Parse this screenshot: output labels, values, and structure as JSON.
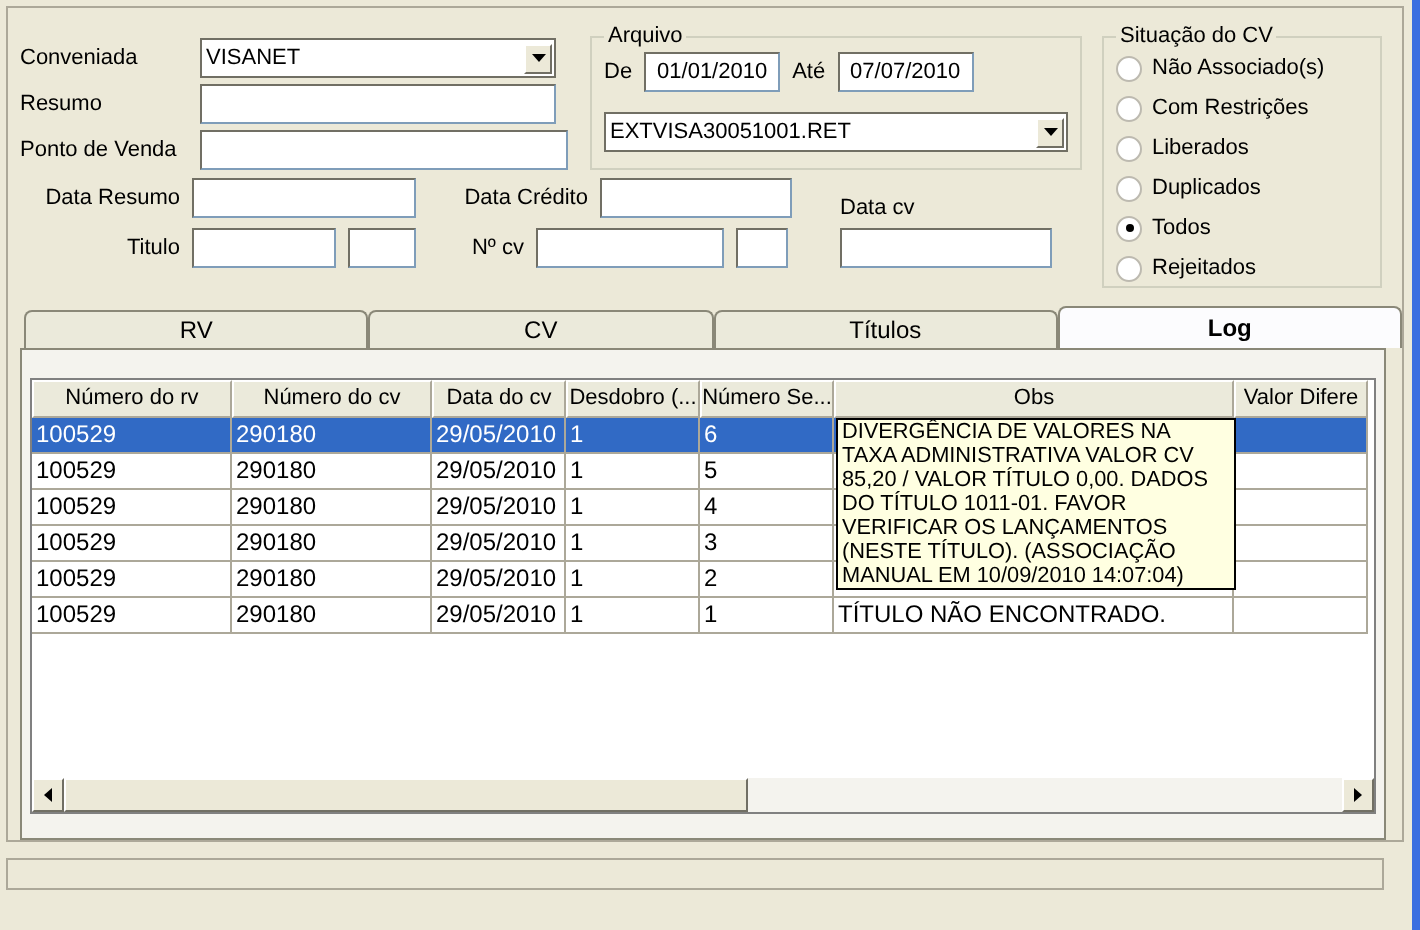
{
  "filters": {
    "conveniada": {
      "label": "Conveniada",
      "value": "VISANET"
    },
    "resumo": {
      "label": "Resumo"
    },
    "ponto_de_venda": {
      "label": "Ponto de Venda"
    },
    "data_resumo": {
      "label": "Data Resumo"
    },
    "data_credito": {
      "label": "Data Crédito"
    },
    "titulo": {
      "label": "Titulo"
    },
    "n_cv": {
      "label": "Nº cv"
    },
    "data_cv": {
      "label": "Data cv"
    }
  },
  "arquivo": {
    "title": "Arquivo",
    "de_label": "De",
    "de": "01/01/2010",
    "ate_label": "Até",
    "ate": "07/07/2010",
    "file": "EXTVISA30051001.RET"
  },
  "situacao": {
    "title": "Situação do CV",
    "options": [
      {
        "label": "Não Associado(s)",
        "selected": false
      },
      {
        "label": "Com Restrições",
        "selected": false
      },
      {
        "label": "Liberados",
        "selected": false
      },
      {
        "label": "Duplicados",
        "selected": false
      },
      {
        "label": "Todos",
        "selected": true
      },
      {
        "label": "Rejeitados",
        "selected": false
      }
    ]
  },
  "tabs": [
    {
      "label": "RV",
      "selected": false
    },
    {
      "label": "CV",
      "selected": false
    },
    {
      "label": "Títulos",
      "selected": false
    },
    {
      "label": "Log",
      "selected": true
    }
  ],
  "table": {
    "columns": [
      "Número do rv",
      "Número do cv",
      "Data do cv",
      "Desdobro (...",
      "Número Se...",
      "Obs",
      "Valor Difere"
    ],
    "rows": [
      {
        "selected": true,
        "cells": [
          "100529",
          "290180",
          "29/05/2010",
          "1",
          "6"
        ]
      },
      {
        "selected": false,
        "cells": [
          "100529",
          "290180",
          "29/05/2010",
          "1",
          "5"
        ]
      },
      {
        "selected": false,
        "cells": [
          "100529",
          "290180",
          "29/05/2010",
          "1",
          "4"
        ]
      },
      {
        "selected": false,
        "cells": [
          "100529",
          "290180",
          "29/05/2010",
          "1",
          "3"
        ]
      },
      {
        "selected": false,
        "cells": [
          "100529",
          "290180",
          "29/05/2010",
          "1",
          "2"
        ]
      },
      {
        "selected": false,
        "cells": [
          "100529",
          "290180",
          "29/05/2010",
          "1",
          "1",
          "TÍTULO NÃO ENCONTRADO."
        ]
      }
    ]
  },
  "tooltip": "DIVERGÊNCIA DE VALORES NA TAXA ADMINISTRATIVA VALOR CV 85,20 / VALOR TÍTULO 0,00. DADOS DO TÍTULO 1011-01. FAVOR VERIFICAR OS LANÇAMENTOS (NESTE TÍTULO). (ASSOCIAÇÃO MANUAL EM 10/09/2010 14:07:04)"
}
